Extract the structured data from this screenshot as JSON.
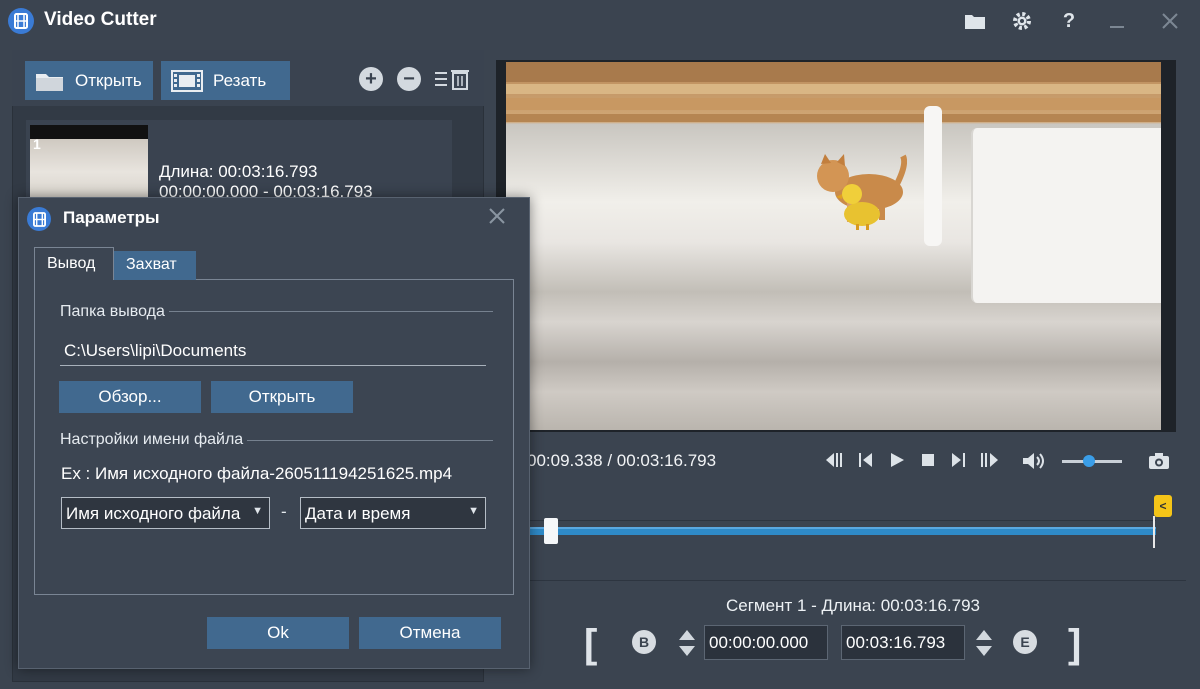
{
  "app": {
    "title": "Video Cutter"
  },
  "titlebar_icons": [
    "folder-icon",
    "gear-icon",
    "help-icon",
    "minimize-icon",
    "close-icon"
  ],
  "titlebar_labels": {
    "help": "?"
  },
  "toolbar": {
    "open_label": "Открыть",
    "cut_label": "Резать",
    "add": "+",
    "remove": "−"
  },
  "file_list": [
    {
      "index": "1",
      "length": "Длина: 00:03:16.793",
      "range": "00:00:00.000  -  00:03:16.793"
    }
  ],
  "player": {
    "time": "00:09.338 / 00:03:16.793",
    "playback_position": 0.048,
    "volume_level": 0.45
  },
  "segment": {
    "info": "Сегмент 1 - Длина: 00:03:16.793",
    "start_bracket": "[",
    "end_bracket": "]",
    "begin_letter": "B",
    "end_letter": "E",
    "start": "00:00:00.000",
    "end": "00:03:16.793",
    "end_marker": "<"
  },
  "dialog": {
    "title": "Параметры",
    "tabs": [
      "Вывод",
      "Захват"
    ],
    "output_folder_label": "Папка вывода",
    "output_folder_value": "C:\\Users\\lipi\\Documents",
    "browse_label": "Обзор...",
    "open_label": "Открыть",
    "filename_settings_label": "Настройки имени файла",
    "example": "Ex : Имя исходного файла-260511194251625.mp4",
    "name_part1": "Имя исходного файла",
    "name_separator": "-",
    "name_part2": "Дата и время",
    "ok_label": "Ok",
    "cancel_label": "Отмена"
  },
  "colors": {
    "background": "#3b4450",
    "button": "#41698f",
    "timeline": "#2e8ac8",
    "end_marker": "#f5c518"
  }
}
